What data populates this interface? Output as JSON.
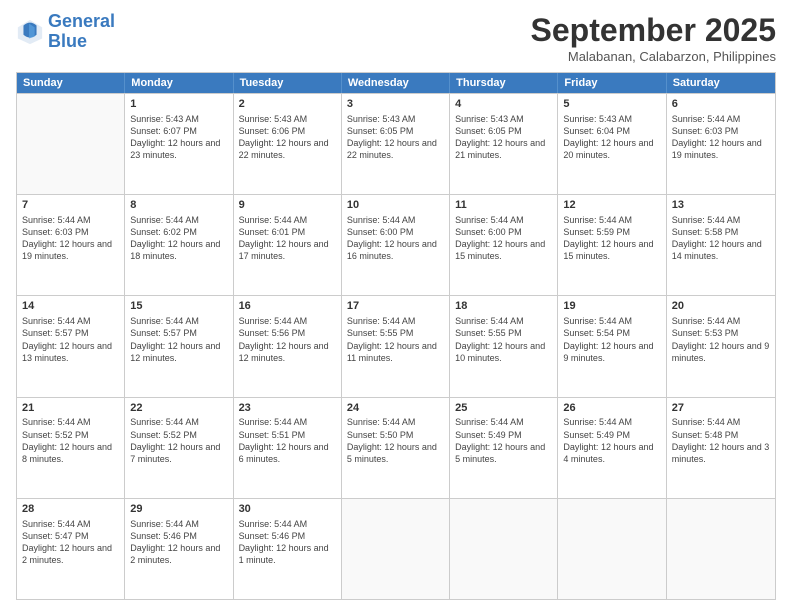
{
  "header": {
    "logo_line1": "General",
    "logo_line2": "Blue",
    "month_title": "September 2025",
    "location": "Malabanan, Calabarzon, Philippines"
  },
  "days_of_week": [
    "Sunday",
    "Monday",
    "Tuesday",
    "Wednesday",
    "Thursday",
    "Friday",
    "Saturday"
  ],
  "weeks": [
    [
      {
        "day": "",
        "sunrise": "",
        "sunset": "",
        "daylight": "",
        "empty": true
      },
      {
        "day": "1",
        "sunrise": "Sunrise: 5:43 AM",
        "sunset": "Sunset: 6:07 PM",
        "daylight": "Daylight: 12 hours and 23 minutes."
      },
      {
        "day": "2",
        "sunrise": "Sunrise: 5:43 AM",
        "sunset": "Sunset: 6:06 PM",
        "daylight": "Daylight: 12 hours and 22 minutes."
      },
      {
        "day": "3",
        "sunrise": "Sunrise: 5:43 AM",
        "sunset": "Sunset: 6:05 PM",
        "daylight": "Daylight: 12 hours and 22 minutes."
      },
      {
        "day": "4",
        "sunrise": "Sunrise: 5:43 AM",
        "sunset": "Sunset: 6:05 PM",
        "daylight": "Daylight: 12 hours and 21 minutes."
      },
      {
        "day": "5",
        "sunrise": "Sunrise: 5:43 AM",
        "sunset": "Sunset: 6:04 PM",
        "daylight": "Daylight: 12 hours and 20 minutes."
      },
      {
        "day": "6",
        "sunrise": "Sunrise: 5:44 AM",
        "sunset": "Sunset: 6:03 PM",
        "daylight": "Daylight: 12 hours and 19 minutes."
      }
    ],
    [
      {
        "day": "7",
        "sunrise": "Sunrise: 5:44 AM",
        "sunset": "Sunset: 6:03 PM",
        "daylight": "Daylight: 12 hours and 19 minutes."
      },
      {
        "day": "8",
        "sunrise": "Sunrise: 5:44 AM",
        "sunset": "Sunset: 6:02 PM",
        "daylight": "Daylight: 12 hours and 18 minutes."
      },
      {
        "day": "9",
        "sunrise": "Sunrise: 5:44 AM",
        "sunset": "Sunset: 6:01 PM",
        "daylight": "Daylight: 12 hours and 17 minutes."
      },
      {
        "day": "10",
        "sunrise": "Sunrise: 5:44 AM",
        "sunset": "Sunset: 6:00 PM",
        "daylight": "Daylight: 12 hours and 16 minutes."
      },
      {
        "day": "11",
        "sunrise": "Sunrise: 5:44 AM",
        "sunset": "Sunset: 6:00 PM",
        "daylight": "Daylight: 12 hours and 15 minutes."
      },
      {
        "day": "12",
        "sunrise": "Sunrise: 5:44 AM",
        "sunset": "Sunset: 5:59 PM",
        "daylight": "Daylight: 12 hours and 15 minutes."
      },
      {
        "day": "13",
        "sunrise": "Sunrise: 5:44 AM",
        "sunset": "Sunset: 5:58 PM",
        "daylight": "Daylight: 12 hours and 14 minutes."
      }
    ],
    [
      {
        "day": "14",
        "sunrise": "Sunrise: 5:44 AM",
        "sunset": "Sunset: 5:57 PM",
        "daylight": "Daylight: 12 hours and 13 minutes."
      },
      {
        "day": "15",
        "sunrise": "Sunrise: 5:44 AM",
        "sunset": "Sunset: 5:57 PM",
        "daylight": "Daylight: 12 hours and 12 minutes."
      },
      {
        "day": "16",
        "sunrise": "Sunrise: 5:44 AM",
        "sunset": "Sunset: 5:56 PM",
        "daylight": "Daylight: 12 hours and 12 minutes."
      },
      {
        "day": "17",
        "sunrise": "Sunrise: 5:44 AM",
        "sunset": "Sunset: 5:55 PM",
        "daylight": "Daylight: 12 hours and 11 minutes."
      },
      {
        "day": "18",
        "sunrise": "Sunrise: 5:44 AM",
        "sunset": "Sunset: 5:55 PM",
        "daylight": "Daylight: 12 hours and 10 minutes."
      },
      {
        "day": "19",
        "sunrise": "Sunrise: 5:44 AM",
        "sunset": "Sunset: 5:54 PM",
        "daylight": "Daylight: 12 hours and 9 minutes."
      },
      {
        "day": "20",
        "sunrise": "Sunrise: 5:44 AM",
        "sunset": "Sunset: 5:53 PM",
        "daylight": "Daylight: 12 hours and 9 minutes."
      }
    ],
    [
      {
        "day": "21",
        "sunrise": "Sunrise: 5:44 AM",
        "sunset": "Sunset: 5:52 PM",
        "daylight": "Daylight: 12 hours and 8 minutes."
      },
      {
        "day": "22",
        "sunrise": "Sunrise: 5:44 AM",
        "sunset": "Sunset: 5:52 PM",
        "daylight": "Daylight: 12 hours and 7 minutes."
      },
      {
        "day": "23",
        "sunrise": "Sunrise: 5:44 AM",
        "sunset": "Sunset: 5:51 PM",
        "daylight": "Daylight: 12 hours and 6 minutes."
      },
      {
        "day": "24",
        "sunrise": "Sunrise: 5:44 AM",
        "sunset": "Sunset: 5:50 PM",
        "daylight": "Daylight: 12 hours and 5 minutes."
      },
      {
        "day": "25",
        "sunrise": "Sunrise: 5:44 AM",
        "sunset": "Sunset: 5:49 PM",
        "daylight": "Daylight: 12 hours and 5 minutes."
      },
      {
        "day": "26",
        "sunrise": "Sunrise: 5:44 AM",
        "sunset": "Sunset: 5:49 PM",
        "daylight": "Daylight: 12 hours and 4 minutes."
      },
      {
        "day": "27",
        "sunrise": "Sunrise: 5:44 AM",
        "sunset": "Sunset: 5:48 PM",
        "daylight": "Daylight: 12 hours and 3 minutes."
      }
    ],
    [
      {
        "day": "28",
        "sunrise": "Sunrise: 5:44 AM",
        "sunset": "Sunset: 5:47 PM",
        "daylight": "Daylight: 12 hours and 2 minutes."
      },
      {
        "day": "29",
        "sunrise": "Sunrise: 5:44 AM",
        "sunset": "Sunset: 5:46 PM",
        "daylight": "Daylight: 12 hours and 2 minutes."
      },
      {
        "day": "30",
        "sunrise": "Sunrise: 5:44 AM",
        "sunset": "Sunset: 5:46 PM",
        "daylight": "Daylight: 12 hours and 1 minute."
      },
      {
        "day": "",
        "sunrise": "",
        "sunset": "",
        "daylight": "",
        "empty": true
      },
      {
        "day": "",
        "sunrise": "",
        "sunset": "",
        "daylight": "",
        "empty": true
      },
      {
        "day": "",
        "sunrise": "",
        "sunset": "",
        "daylight": "",
        "empty": true
      },
      {
        "day": "",
        "sunrise": "",
        "sunset": "",
        "daylight": "",
        "empty": true
      }
    ]
  ]
}
